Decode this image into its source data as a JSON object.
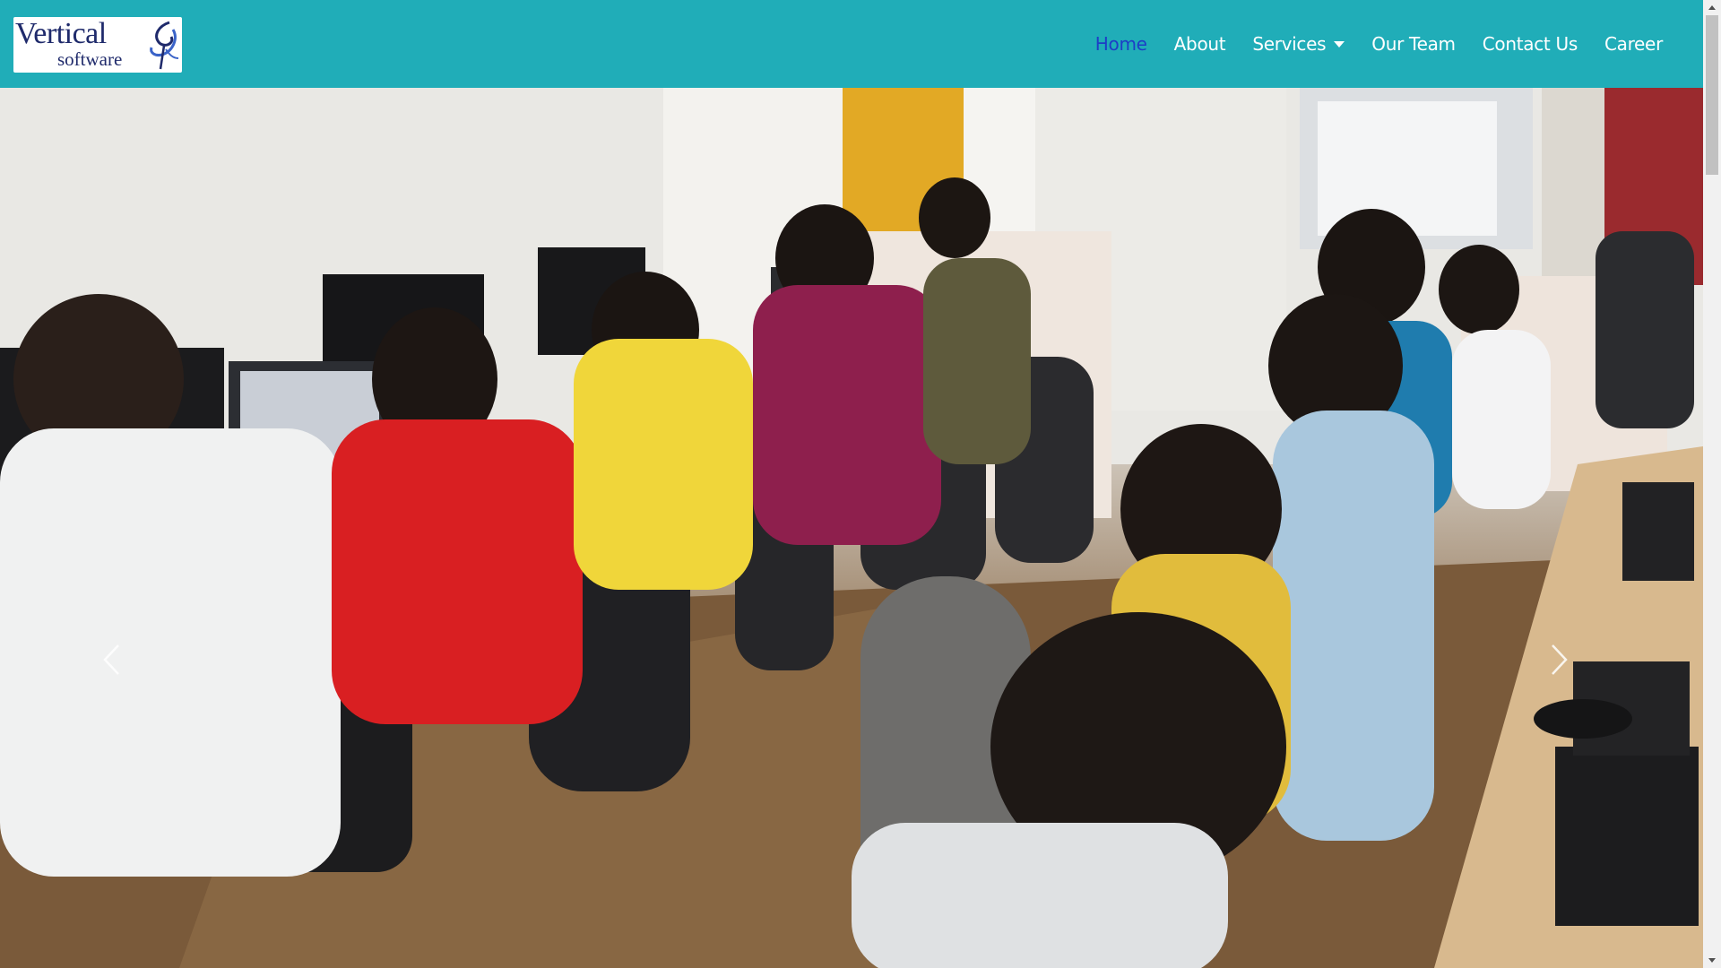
{
  "brand": {
    "name_line1": "Vertical",
    "name_line2": "software",
    "logo_icon": "swirl-logo-icon"
  },
  "nav": {
    "items": [
      {
        "label": "Home",
        "active": true
      },
      {
        "label": "About"
      },
      {
        "label": "Services",
        "dropdown": true
      },
      {
        "label": "Our Team"
      },
      {
        "label": "Contact Us"
      },
      {
        "label": "Career"
      }
    ]
  },
  "carousel": {
    "prev_icon": "chevron-left-icon",
    "next_icon": "chevron-right-icon"
  },
  "colors": {
    "navbar": "#20adb8",
    "active_link": "#1d3ec6",
    "logo_text": "#1f2a6b"
  }
}
